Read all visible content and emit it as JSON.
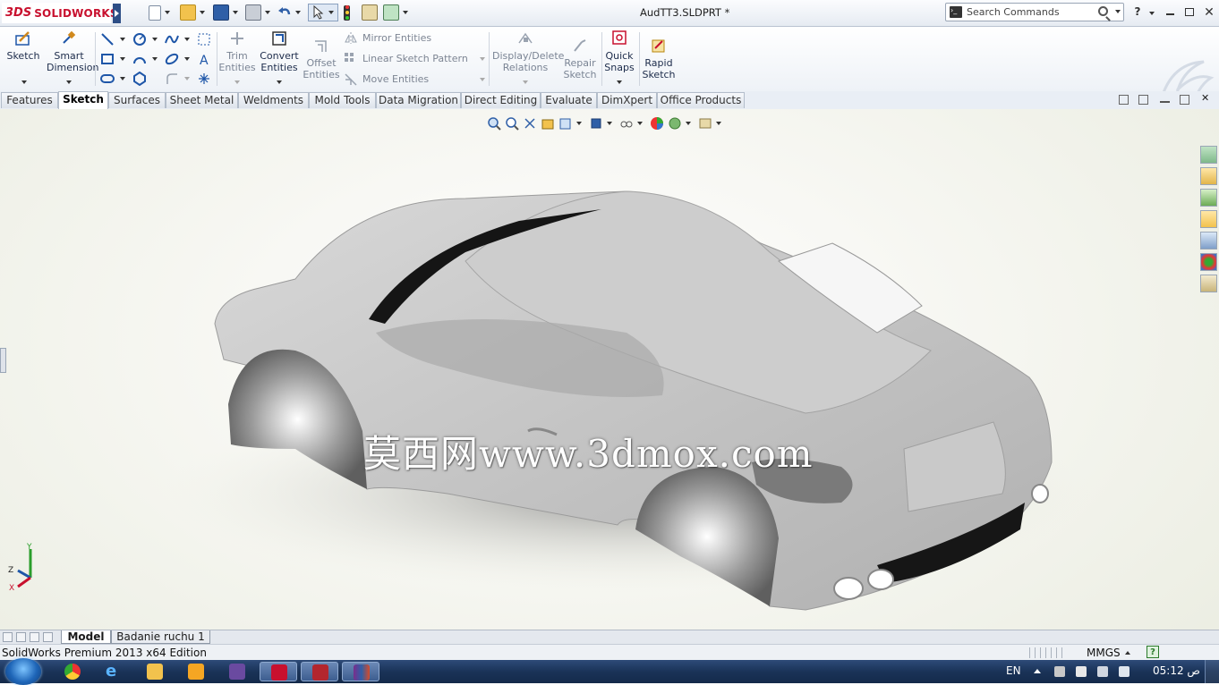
{
  "app": {
    "brand_mark": "3DS",
    "brand_name": "SOLIDWORKS",
    "document_title": "AudTT3.SLDPRT *"
  },
  "search": {
    "placeholder": "Search Commands",
    "help_label": "?"
  },
  "command_manager": {
    "sketch": "Sketch",
    "smart_dimension": [
      "Smart",
      "Dimension"
    ],
    "trim_entities": [
      "Trim",
      "Entities"
    ],
    "convert_entities": [
      "Convert",
      "Entities"
    ],
    "offset_entities": [
      "Offset",
      "Entities"
    ],
    "mirror_entities": "Mirror Entities",
    "linear_sketch_pattern": "Linear Sketch Pattern",
    "move_entities": "Move Entities",
    "display_delete_relations": [
      "Display/Delete",
      "Relations"
    ],
    "repair_sketch": [
      "Repair",
      "Sketch"
    ],
    "quick_snaps": [
      "Quick",
      "Snaps"
    ],
    "rapid_sketch": [
      "Rapid",
      "Sketch"
    ]
  },
  "tabs": [
    "Features",
    "Sketch",
    "Surfaces",
    "Sheet Metal",
    "Weldments",
    "Mold Tools",
    "Data Migration",
    "Direct Editing",
    "Evaluate",
    "DimXpert",
    "Office Products"
  ],
  "active_tab": "Sketch",
  "viewport": {
    "watermark": "莫西网www.3dmox.com",
    "triad": {
      "y": "Y",
      "z": "Z",
      "x": "X"
    }
  },
  "model_tabs": [
    "Model",
    "Badanie ruchu 1"
  ],
  "status": {
    "text": "SolidWorks Premium 2013 x64 Edition",
    "units": "MMGS",
    "units_help": "?"
  },
  "taskbar": {
    "language": "EN",
    "clock": "05:12 ص"
  },
  "colors": {
    "brand": "#c8102e",
    "tab_bar": "#e9eef5",
    "taskbar": "#1a3358"
  }
}
